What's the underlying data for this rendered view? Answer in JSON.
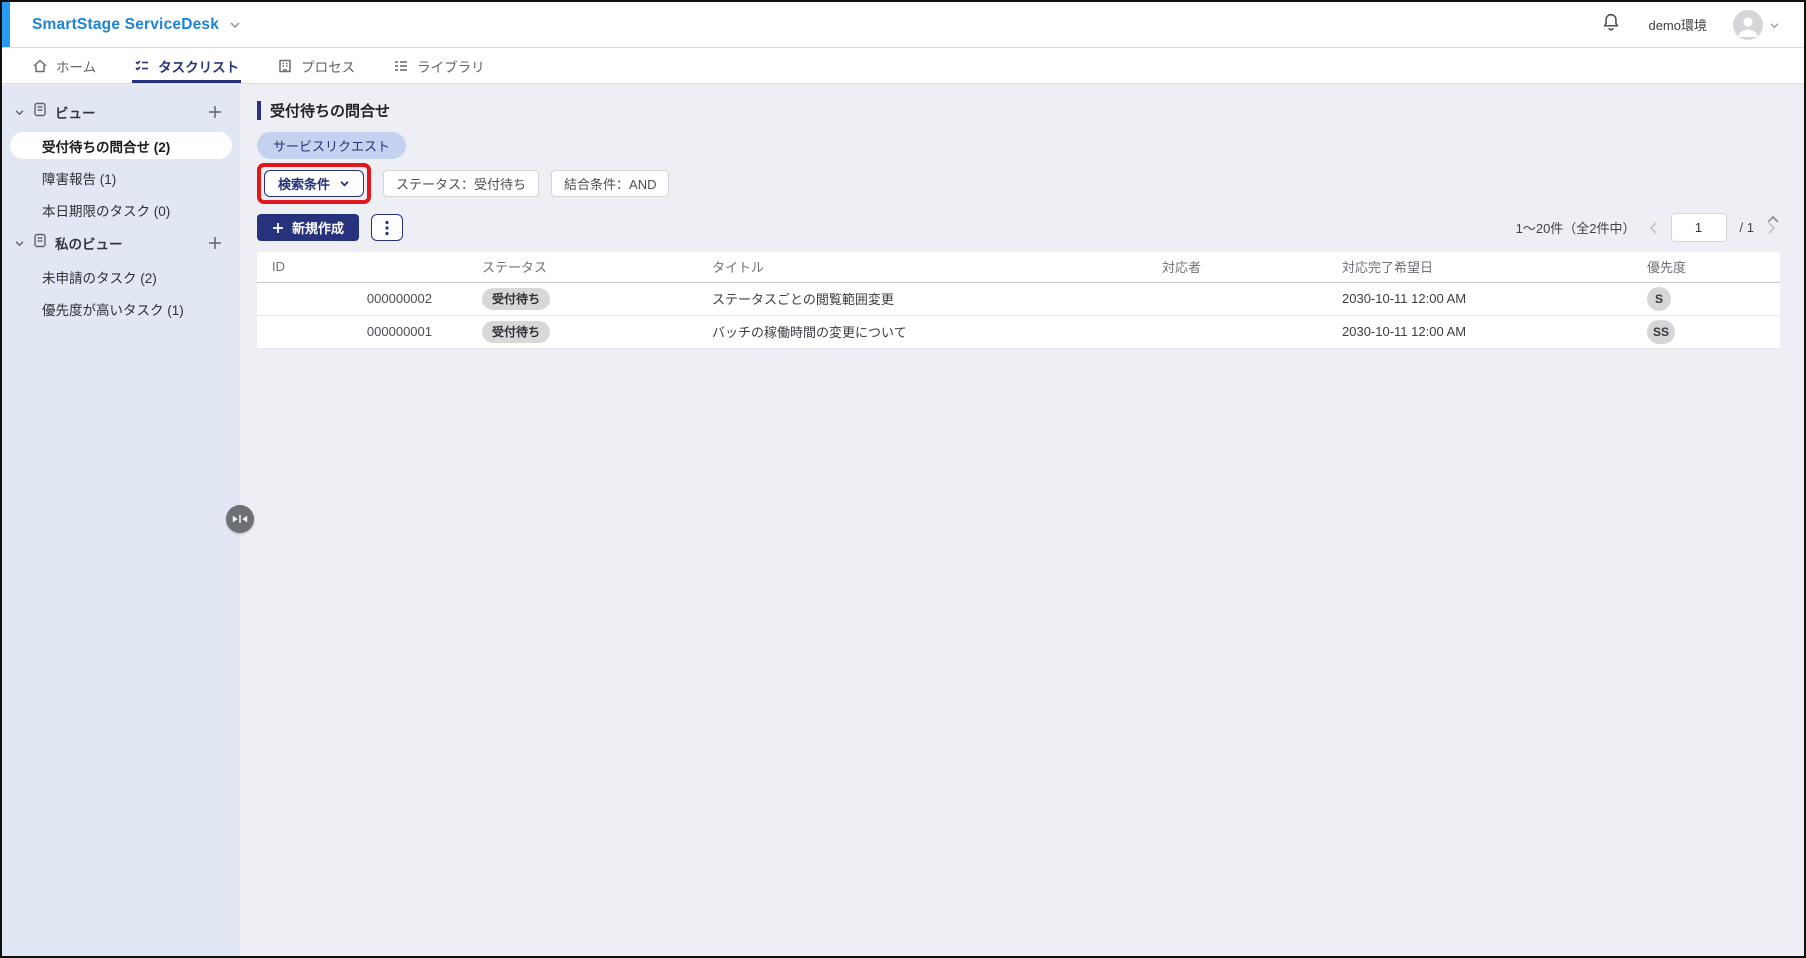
{
  "app": {
    "brand": "SmartStage ServiceDesk",
    "environment": "demo環境"
  },
  "nav": {
    "tabs": [
      {
        "label": "ホーム"
      },
      {
        "label": "タスクリスト"
      },
      {
        "label": "プロセス"
      },
      {
        "label": "ライブラリ"
      }
    ]
  },
  "sidebar": {
    "sections": [
      {
        "label": "ビュー",
        "items": [
          {
            "label": "受付待ちの問合せ (2)"
          },
          {
            "label": "障害報告 (1)"
          },
          {
            "label": "本日期限のタスク (0)"
          }
        ]
      },
      {
        "label": "私のビュー",
        "items": [
          {
            "label": "未申請のタスク (2)"
          },
          {
            "label": "優先度が高いタスク (1)"
          }
        ]
      }
    ]
  },
  "main": {
    "title": "受付待ちの問合せ",
    "category_chip": "サービスリクエスト",
    "filter": {
      "search_button": "検索条件",
      "condition_chips": [
        "ステータス：受付待ち",
        "結合条件：AND"
      ]
    },
    "create_button": "新規作成",
    "pagination": {
      "range": "1〜20件（全2件中）",
      "page": "1",
      "total": "/ 1"
    },
    "table": {
      "columns": [
        "ID",
        "ステータス",
        "タイトル",
        "対応者",
        "対応完了希望日",
        "優先度"
      ],
      "rows": [
        {
          "id": "000000002",
          "status": "受付待ち",
          "title": "ステータスごとの閲覧範囲変更",
          "assignee": "",
          "due_date": "2030-10-11 12:00 AM",
          "priority": "S"
        },
        {
          "id": "000000001",
          "status": "受付待ち",
          "title": "バッチの稼働時間の変更について",
          "assignee": "",
          "due_date": "2030-10-11 12:00 AM",
          "priority": "SS"
        }
      ]
    }
  },
  "colors": {
    "brand_blue": "#1d83d4",
    "accent_navy": "#26337c",
    "header_stripe": "#2b9af3",
    "annotation_red": "#e0171b",
    "category_chip_bg": "#c4d2ef",
    "badge_gray_bg": "#d8d8da",
    "sidebar_bg": "#e2e7f4",
    "main_bg": "#edeff4"
  }
}
